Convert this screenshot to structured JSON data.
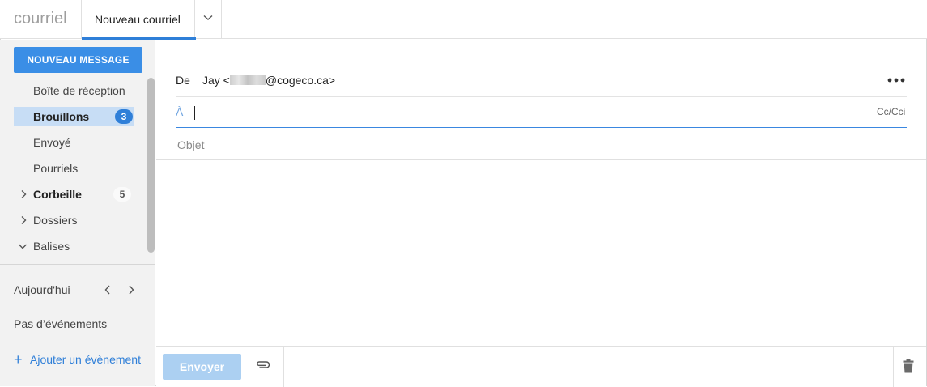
{
  "app": {
    "title": "courriel"
  },
  "tabs": [
    {
      "label": "Nouveau courriel",
      "active": true
    }
  ],
  "sidebar": {
    "new_message_label": "NOUVEAU MESSAGE",
    "folders": [
      {
        "label": "Boîte de réception"
      },
      {
        "label": "Brouillons",
        "count": "3",
        "selected": true
      },
      {
        "label": "Envoyé"
      },
      {
        "label": "Pourriels"
      },
      {
        "label": "Corbeille",
        "count": "5",
        "expandable": true
      },
      {
        "label": "Dossiers",
        "expandable": true
      },
      {
        "label": "Balises",
        "expanded": true
      }
    ],
    "calendar": {
      "today_label": "Aujourd'hui",
      "no_events": "Pas d’événements",
      "add_event": "Ajouter un évènement"
    }
  },
  "compose": {
    "from_label": "De",
    "from_name": "Jay <",
    "from_domain": "@cogeco.ca>",
    "to_label": "À",
    "to_value": "",
    "cc_label": "Cc/Cci",
    "subject_placeholder": "Objet",
    "subject_value": ""
  },
  "footer": {
    "send_label": "Envoyer"
  },
  "colors": {
    "accent": "#3a8ee6",
    "selected_bg": "#c7ddf5",
    "send_disabled": "#acd0f2",
    "sidebar_bg": "#f2f2f2"
  },
  "icons": [
    "chevron-down-icon",
    "chevron-right-icon",
    "chevron-left-icon",
    "more-icon",
    "paperclip-icon",
    "trash-icon",
    "plus-icon"
  ]
}
